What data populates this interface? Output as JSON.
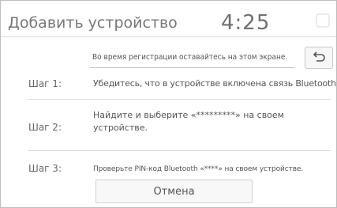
{
  "header": {
    "title": "Добавить устройство",
    "clock": "4:25"
  },
  "notice": {
    "text": "Во время регистрации оставайтесь на этом экране."
  },
  "back_button": {
    "icon": "back-arrow-icon"
  },
  "steps": [
    {
      "label": "Шаг 1:",
      "text": "Убедитесь, что в устройстве включена связь Bluetooth."
    },
    {
      "label": "Шаг 2:",
      "text": "Найдите и выберите «*********» на своем устройстве."
    },
    {
      "label": "Шаг 3:",
      "text": "Проверьте PIN-код Bluetooth «****» на своем устройстве."
    }
  ],
  "cancel_button": {
    "label": "Отмена"
  }
}
